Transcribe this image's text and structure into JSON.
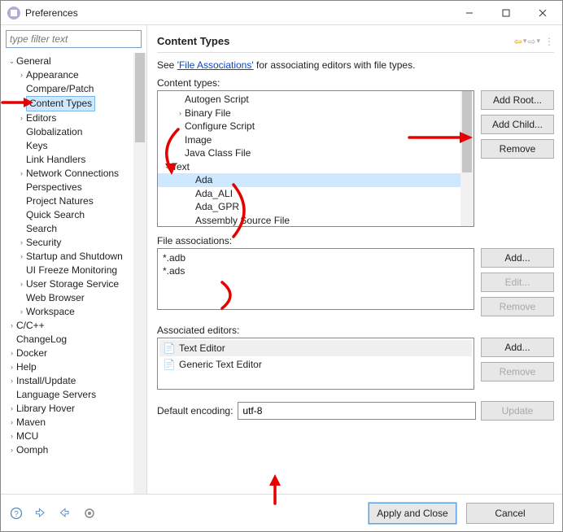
{
  "window": {
    "title": "Preferences"
  },
  "filter_placeholder": "type filter text",
  "tree": {
    "items": [
      "General",
      "Appearance",
      "Compare/Patch",
      "Content Types",
      "Editors",
      "Globalization",
      "Keys",
      "Link Handlers",
      "Network Connections",
      "Perspectives",
      "Project Natures",
      "Quick Search",
      "Search",
      "Security",
      "Startup and Shutdown",
      "UI Freeze Monitoring",
      "User Storage Service",
      "Web Browser",
      "Workspace",
      "C/C++",
      "ChangeLog",
      "Docker",
      "Help",
      "Install/Update",
      "Language Servers",
      "Library Hover",
      "Maven",
      "MCU",
      "Oomph"
    ]
  },
  "main": {
    "title": "Content Types",
    "desc_prefix": "See ",
    "desc_link": "'File Associations'",
    "desc_suffix": " for associating editors with file types.",
    "content_types_label": "Content types:",
    "content_types": [
      "Autogen Script",
      "Binary File",
      "Configure Script",
      "Image",
      "Java Class File",
      "Text",
      "Ada",
      "Ada_ALI",
      "Ada_GPR",
      "Assembly Source File"
    ],
    "buttons": {
      "add_root": "Add Root...",
      "add_child": "Add Child...",
      "remove": "Remove",
      "add": "Add...",
      "edit": "Edit...",
      "remove2": "Remove",
      "add2": "Add...",
      "remove3": "Remove",
      "update": "Update"
    },
    "file_assoc_label": "File associations:",
    "file_assoc": [
      "*.adb",
      "*.ads"
    ],
    "assoc_editors_label": "Associated editors:",
    "assoc_editors": [
      "Text Editor",
      "Generic Text Editor"
    ],
    "encoding_label": "Default encoding:",
    "encoding_value": "utf-8"
  },
  "footer": {
    "apply": "Apply and Close",
    "cancel": "Cancel"
  }
}
